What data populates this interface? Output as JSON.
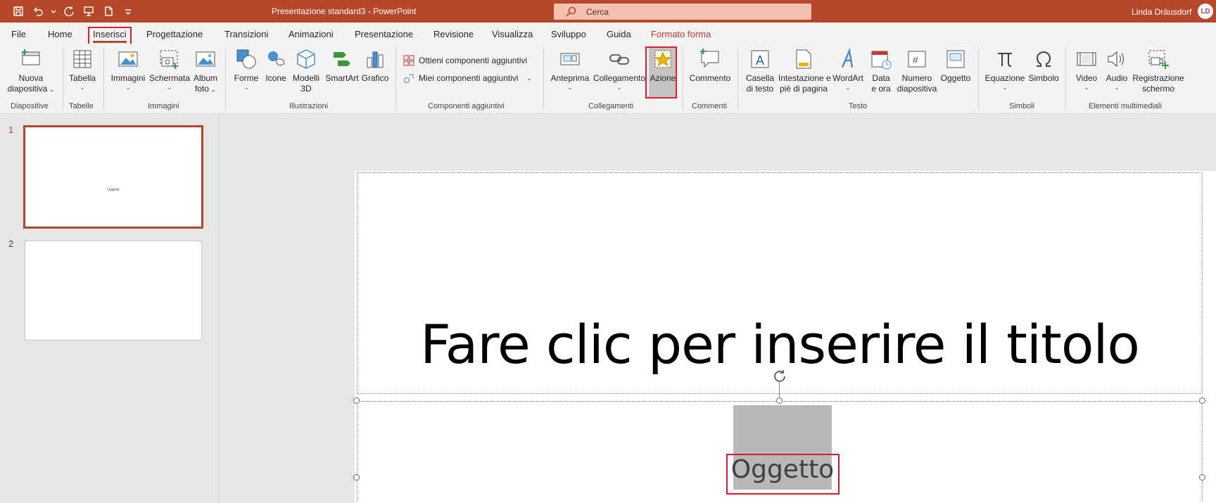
{
  "app": {
    "doc_title": "Presentazione standard3 - PowerPoint",
    "search_placeholder": "Cerca",
    "user_name": "Linda Dräusdorf",
    "user_initials": "LD",
    "brand_color": "#b7472a"
  },
  "menu_tabs": [
    {
      "label": "File"
    },
    {
      "label": "Home"
    },
    {
      "label": "Inserisci",
      "active": true
    },
    {
      "label": "Progettazione"
    },
    {
      "label": "Transizioni"
    },
    {
      "label": "Animazioni"
    },
    {
      "label": "Presentazione"
    },
    {
      "label": "Revisione"
    },
    {
      "label": "Visualizza"
    },
    {
      "label": "Sviluppo"
    },
    {
      "label": "Guida"
    },
    {
      "label": "Formato forma",
      "contextual": true
    }
  ],
  "ribbon": {
    "groups": {
      "diapositive": "Diapositive",
      "tabelle": "Tabelle",
      "immagini": "Immagini",
      "illustrazioni": "Illustrazioni",
      "componenti": "Componenti aggiuntivi",
      "collegamenti": "Collegamenti",
      "commenti": "Commenti",
      "testo": "Testo",
      "simboli": "Simboli",
      "multimedia": "Elementi multimediali"
    },
    "buttons": {
      "nuova_1": "Nuova",
      "nuova_2": "diapositiva",
      "tabella": "Tabella",
      "immagini": "Immagini",
      "schermata": "Schermata",
      "album_1": "Album",
      "album_2": "foto",
      "forme": "Forme",
      "icone": "Icone",
      "modelli_1": "Modelli",
      "modelli_2": "3D",
      "smartart": "SmartArt",
      "grafico": "Grafico",
      "ottieni": "Ottieni componenti aggiuntivi",
      "miei": "Miei componenti aggiuntivi",
      "anteprima": "Anteprima",
      "collegamento": "Collegamento",
      "azione": "Azione",
      "commento": "Commento",
      "casella_1": "Casella",
      "casella_2": "di testo",
      "intestazione_1": "Intestazione e",
      "intestazione_2": "piè di pagina",
      "wordart": "WordArt",
      "data_1": "Data",
      "data_2": "e ora",
      "numero_1": "Numero",
      "numero_2": "diapositiva",
      "oggetto": "Oggetto",
      "equazione": "Equazione",
      "simbolo": "Simbolo",
      "video": "Video",
      "audio": "Audio",
      "registrazione_1": "Registrazione",
      "registrazione_2": "schermo"
    }
  },
  "slides": [
    {
      "number": "1",
      "thumb_text": "Oggetto"
    },
    {
      "number": "2"
    }
  ],
  "canvas": {
    "title_placeholder": "Fare clic per inserire il titolo",
    "object_text": "Oggetto"
  }
}
